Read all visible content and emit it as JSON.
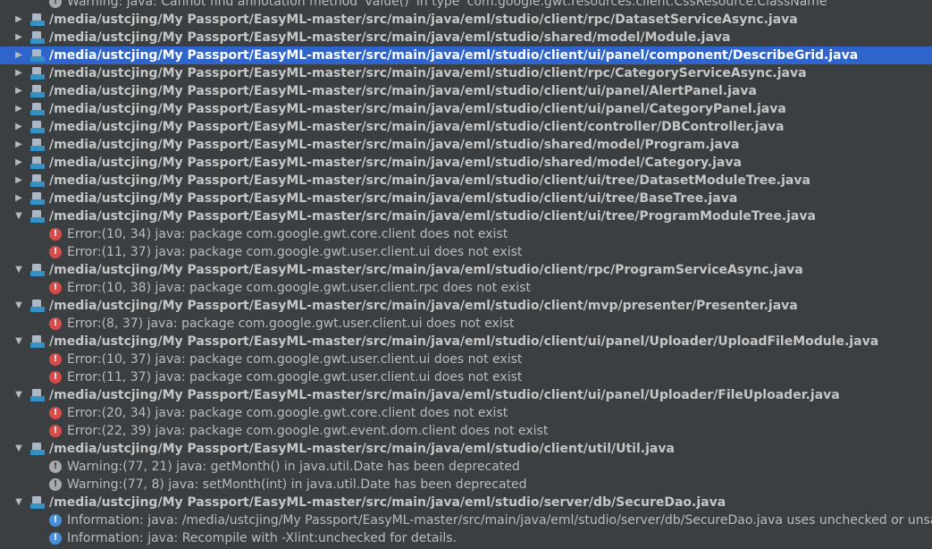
{
  "rows": [
    {
      "kind": "msg",
      "level": "warning",
      "text": "Warning: java: Cannot find annotation method 'value()' in type 'com.google.gwt.resources.client.CssResource.ClassName'"
    },
    {
      "kind": "file",
      "expanded": false,
      "path": "/media/ustcjing/My Passport/EasyML-master/src/main/java/eml/studio/client/rpc/DatasetServiceAsync.java"
    },
    {
      "kind": "file",
      "expanded": false,
      "path": "/media/ustcjing/My Passport/EasyML-master/src/main/java/eml/studio/shared/model/Module.java"
    },
    {
      "kind": "file",
      "expanded": false,
      "selected": true,
      "path": "/media/ustcjing/My Passport/EasyML-master/src/main/java/eml/studio/client/ui/panel/component/DescribeGrid.java"
    },
    {
      "kind": "file",
      "expanded": false,
      "path": "/media/ustcjing/My Passport/EasyML-master/src/main/java/eml/studio/client/rpc/CategoryServiceAsync.java"
    },
    {
      "kind": "file",
      "expanded": false,
      "path": "/media/ustcjing/My Passport/EasyML-master/src/main/java/eml/studio/client/ui/panel/AlertPanel.java"
    },
    {
      "kind": "file",
      "expanded": false,
      "path": "/media/ustcjing/My Passport/EasyML-master/src/main/java/eml/studio/client/ui/panel/CategoryPanel.java"
    },
    {
      "kind": "file",
      "expanded": false,
      "path": "/media/ustcjing/My Passport/EasyML-master/src/main/java/eml/studio/client/controller/DBController.java"
    },
    {
      "kind": "file",
      "expanded": false,
      "path": "/media/ustcjing/My Passport/EasyML-master/src/main/java/eml/studio/shared/model/Program.java"
    },
    {
      "kind": "file",
      "expanded": false,
      "path": "/media/ustcjing/My Passport/EasyML-master/src/main/java/eml/studio/shared/model/Category.java"
    },
    {
      "kind": "file",
      "expanded": false,
      "path": "/media/ustcjing/My Passport/EasyML-master/src/main/java/eml/studio/client/ui/tree/DatasetModuleTree.java"
    },
    {
      "kind": "file",
      "expanded": false,
      "path": "/media/ustcjing/My Passport/EasyML-master/src/main/java/eml/studio/client/ui/tree/BaseTree.java"
    },
    {
      "kind": "file",
      "expanded": true,
      "path": "/media/ustcjing/My Passport/EasyML-master/src/main/java/eml/studio/client/ui/tree/ProgramModuleTree.java"
    },
    {
      "kind": "msg",
      "level": "error",
      "text": "Error:(10, 34)  java: package com.google.gwt.core.client does not exist"
    },
    {
      "kind": "msg",
      "level": "error",
      "text": "Error:(11, 37)  java: package com.google.gwt.user.client.ui does not exist"
    },
    {
      "kind": "file",
      "expanded": true,
      "path": "/media/ustcjing/My Passport/EasyML-master/src/main/java/eml/studio/client/rpc/ProgramServiceAsync.java"
    },
    {
      "kind": "msg",
      "level": "error",
      "text": "Error:(10, 38)  java: package com.google.gwt.user.client.rpc does not exist"
    },
    {
      "kind": "file",
      "expanded": true,
      "path": "/media/ustcjing/My Passport/EasyML-master/src/main/java/eml/studio/client/mvp/presenter/Presenter.java"
    },
    {
      "kind": "msg",
      "level": "error",
      "text": "Error:(8, 37)  java: package com.google.gwt.user.client.ui does not exist"
    },
    {
      "kind": "file",
      "expanded": true,
      "path": "/media/ustcjing/My Passport/EasyML-master/src/main/java/eml/studio/client/ui/panel/Uploader/UploadFileModule.java"
    },
    {
      "kind": "msg",
      "level": "error",
      "text": "Error:(10, 37)  java: package com.google.gwt.user.client.ui does not exist"
    },
    {
      "kind": "msg",
      "level": "error",
      "text": "Error:(11, 37)  java: package com.google.gwt.user.client.ui does not exist"
    },
    {
      "kind": "file",
      "expanded": true,
      "path": "/media/ustcjing/My Passport/EasyML-master/src/main/java/eml/studio/client/ui/panel/Uploader/FileUploader.java"
    },
    {
      "kind": "msg",
      "level": "error",
      "text": "Error:(20, 34)  java: package com.google.gwt.core.client does not exist"
    },
    {
      "kind": "msg",
      "level": "error",
      "text": "Error:(22, 39)  java: package com.google.gwt.event.dom.client does not exist"
    },
    {
      "kind": "file",
      "expanded": true,
      "path": "/media/ustcjing/My Passport/EasyML-master/src/main/java/eml/studio/client/util/Util.java"
    },
    {
      "kind": "msg",
      "level": "warning",
      "text": "Warning:(77, 21)  java: getMonth() in java.util.Date has been deprecated"
    },
    {
      "kind": "msg",
      "level": "warning",
      "text": "Warning:(77, 8)  java: setMonth(int) in java.util.Date has been deprecated"
    },
    {
      "kind": "file",
      "expanded": true,
      "path": "/media/ustcjing/My Passport/EasyML-master/src/main/java/eml/studio/server/db/SecureDao.java"
    },
    {
      "kind": "msg",
      "level": "info",
      "text": "Information: java: /media/ustcjing/My Passport/EasyML-master/src/main/java/eml/studio/server/db/SecureDao.java uses unchecked or unsafe operations."
    },
    {
      "kind": "msg",
      "level": "info",
      "text": "Information: java: Recompile with -Xlint:unchecked for details."
    }
  ],
  "glyphs": {
    "expanded": "▼",
    "collapsed": "▶",
    "error": "!",
    "warning": "!",
    "info": "!"
  },
  "icons": {
    "file": "java-file-icon",
    "error": "error-icon",
    "warning": "warning-icon",
    "info": "info-icon",
    "expanded": "expanded-arrow-icon",
    "collapsed": "collapsed-arrow-icon"
  }
}
